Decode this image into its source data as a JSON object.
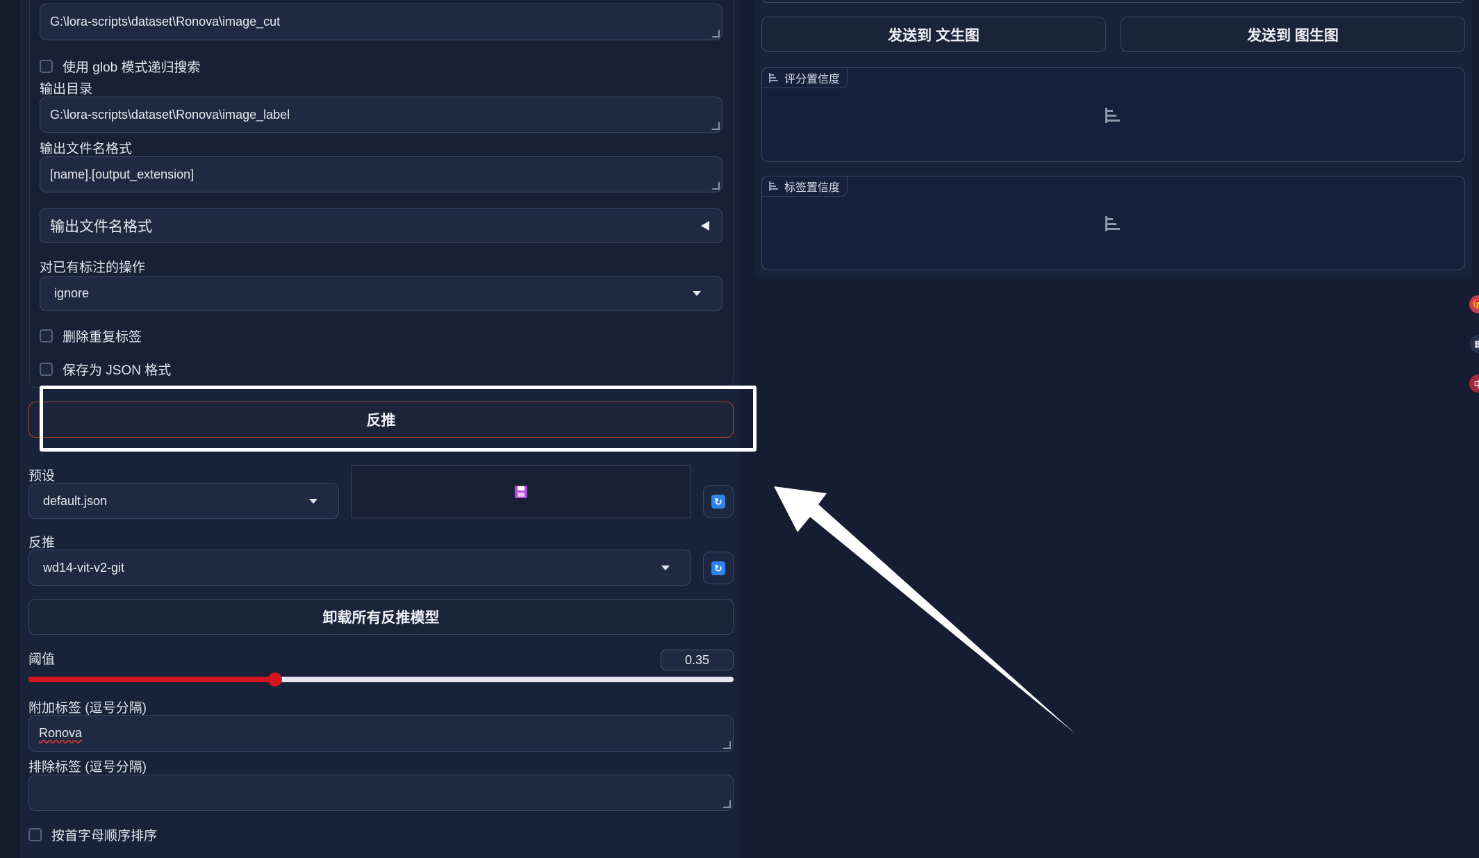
{
  "left": {
    "input_dir_value": "G:\\lora-scripts\\dataset\\Ronova\\image_cut",
    "glob_recursive_label": "使用 glob 模式递归搜索",
    "output_dir_label": "输出目录",
    "output_dir_value": "G:\\lora-scripts\\dataset\\Ronova\\image_label",
    "output_filename_format_label": "输出文件名格式",
    "output_filename_format_value": "[name].[output_extension]",
    "output_filename_format_accordion": "输出文件名格式",
    "existing_caption_action_label": "对已有标注的操作",
    "existing_caption_action_value": "ignore",
    "remove_duplicates_label": "删除重复标签",
    "save_json_label": "保存为 JSON 格式",
    "interrogate_button": "反推",
    "preset_label": "预设",
    "preset_value": "default.json",
    "interrogator_label": "反推",
    "interrogator_value": "wd14-vit-v2-git",
    "unload_models_button": "卸载所有反推模型",
    "threshold_label": "阈值",
    "threshold_value": "0.35",
    "threshold_fraction": 0.35,
    "additional_tags_label": "附加标签 (逗号分隔)",
    "additional_tags_value": "Ronova",
    "exclude_tags_label": "排除标签 (逗号分隔)",
    "exclude_tags_value": "",
    "sort_alpha_label": "按首字母顺序排序"
  },
  "right": {
    "send_to_txt2img_button": "发送到 文生图",
    "send_to_img2img_button": "发送到 图生图",
    "rating_confidence_label": "评分置信度",
    "tag_confidence_label": "标签置信度"
  },
  "side_dots": [
    {
      "name": "gift-icon",
      "glyph": "🎁",
      "color": "#c2405a"
    },
    {
      "name": "grid-icon",
      "glyph": "▦",
      "color": "#26304a"
    },
    {
      "name": "chinese-input-icon",
      "glyph": "中",
      "color": "#a3283c"
    }
  ],
  "colors": {
    "accent_red": "#d3151f",
    "refresh_blue": "#2f84e8",
    "save_icon_purple": "#b14ad6"
  }
}
